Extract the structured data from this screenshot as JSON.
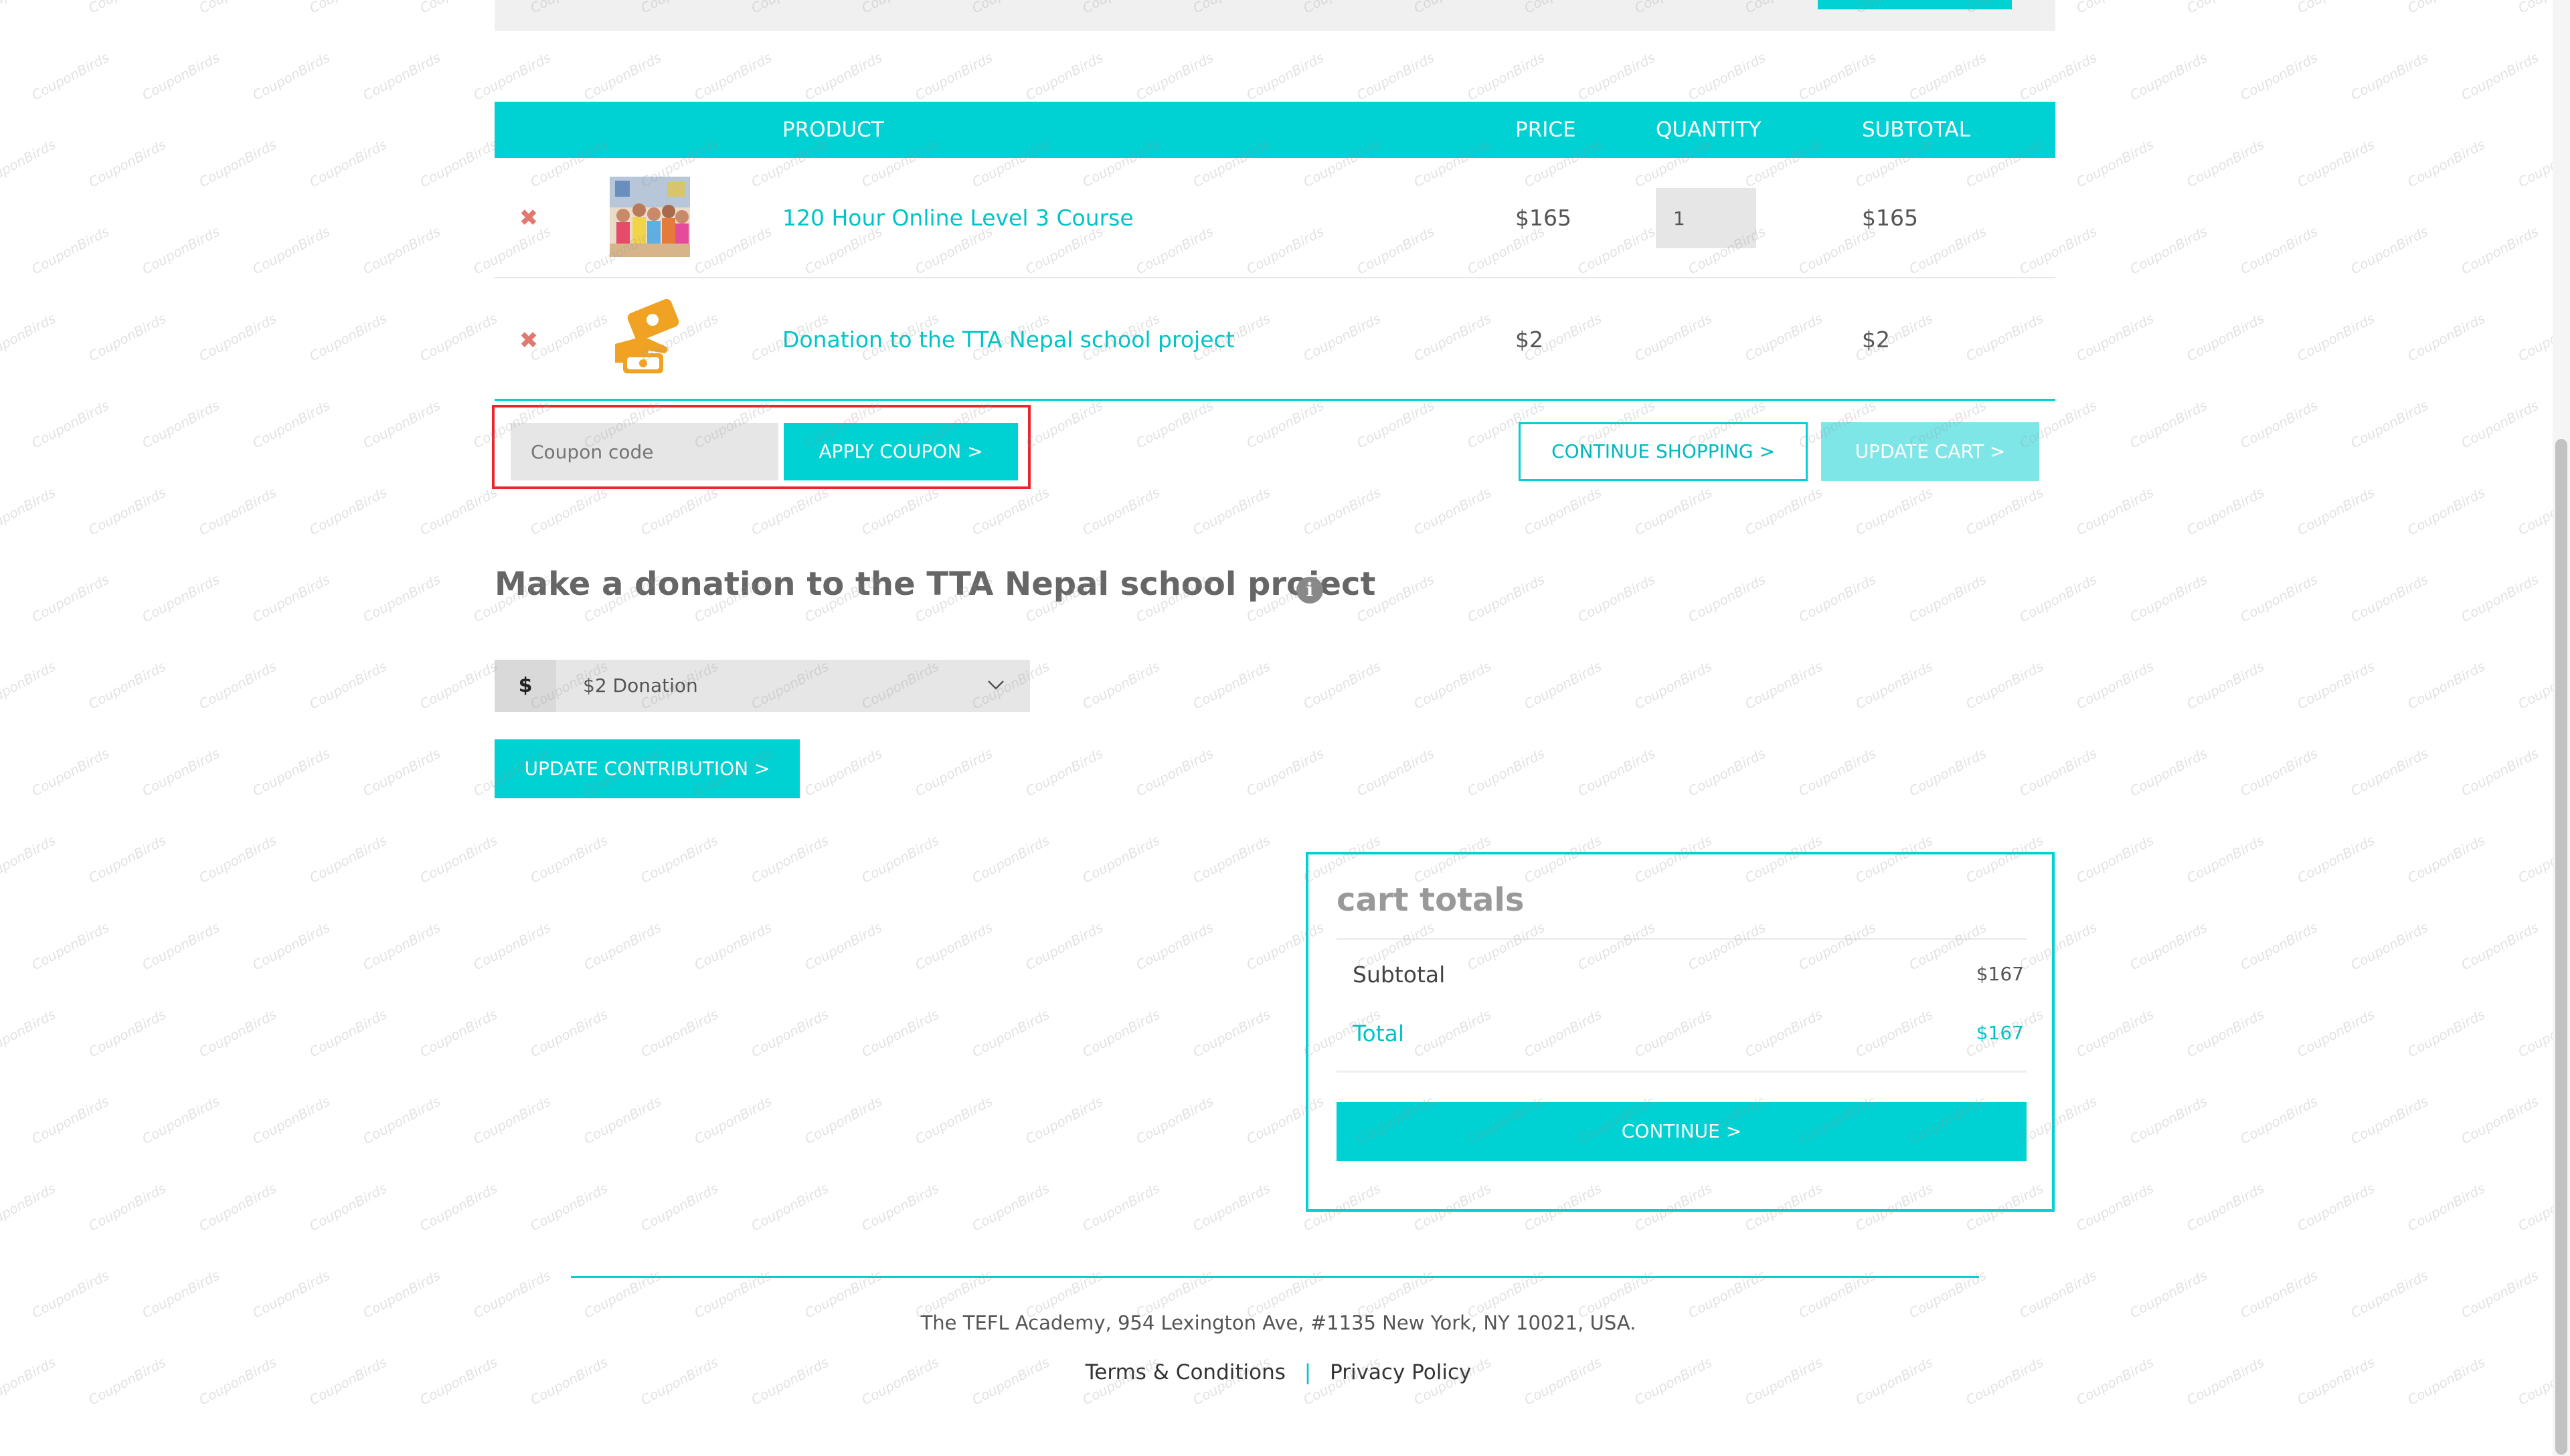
{
  "table": {
    "headers": {
      "product": "PRODUCT",
      "price": "PRICE",
      "quantity": "QUANTITY",
      "subtotal": "SUBTOTAL"
    },
    "rows": [
      {
        "name": "120 Hour Online Level 3 Course",
        "price": "$165",
        "quantity": "1",
        "subtotal": "$165",
        "thumbnail": "class-photo"
      },
      {
        "name": "Donation to the TTA Nepal school project",
        "price": "$2",
        "quantity": "",
        "subtotal": "$2",
        "thumbnail": "donation-hand-icon"
      }
    ]
  },
  "coupon": {
    "placeholder": "Coupon code",
    "apply_label": "APPLY COUPON >"
  },
  "cart_actions": {
    "continue_shopping": "CONTINUE SHOPPING >",
    "update_cart": "UPDATE CART >"
  },
  "donation": {
    "heading": "Make a donation to the TTA Nepal school project",
    "currency": "$",
    "selected": "$2 Donation",
    "update_label": "UPDATE CONTRIBUTION >"
  },
  "cart_totals": {
    "title": "cart totals",
    "subtotal_label": "Subtotal",
    "subtotal_value": "$167",
    "total_label": "Total",
    "total_value": "$167",
    "continue_label": "CONTINUE >"
  },
  "footer": {
    "address": "The TEFL Academy, 954 Lexington Ave, #1135 New York, NY 10021, USA.",
    "links": [
      "Terms & Conditions",
      "Privacy Policy"
    ],
    "separator": "|"
  },
  "watermark_text": "CouponBirds",
  "colors": {
    "accent": "#00d1d3",
    "remove": "#e2796f",
    "highlight": "#e8262c"
  }
}
